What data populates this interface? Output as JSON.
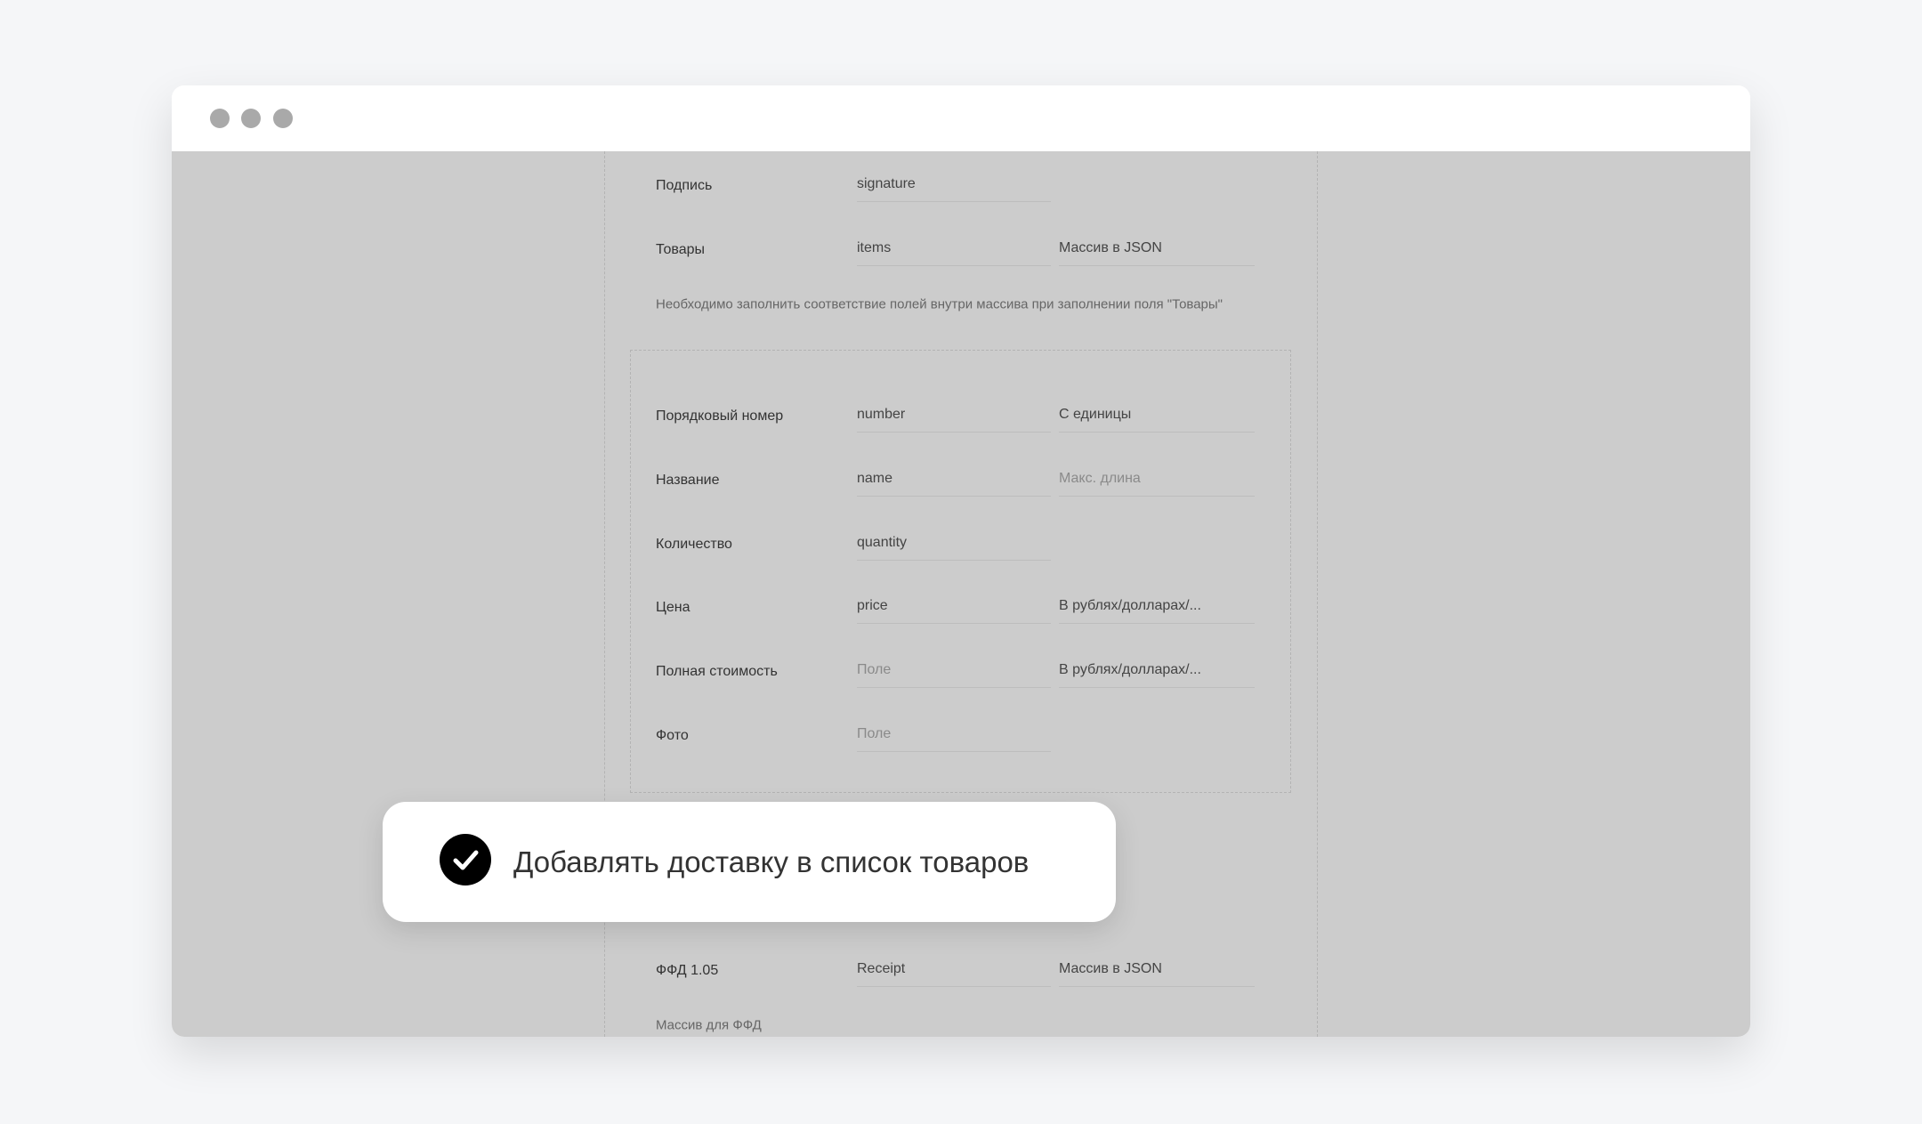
{
  "window": {
    "controls": [
      "close",
      "minimize",
      "maximize"
    ]
  },
  "form": {
    "rows": [
      {
        "label": "Подпись",
        "field": "signature",
        "extra": null
      },
      {
        "label": "Товары",
        "field": "items",
        "extra": "Массив в JSON"
      }
    ],
    "items_note": "Необходимо заполнить соответствие полей внутри массива при заполнении поля \"Товары\"",
    "item_rows": [
      {
        "label": "Порядковый номер",
        "field": "number",
        "extra": "С единицы"
      },
      {
        "label": "Название",
        "field": "name",
        "extra_placeholder": "Макс. длина"
      },
      {
        "label": "Количество",
        "field": "quantity"
      },
      {
        "label": "Цена",
        "field": "price",
        "extra": "В рублях/долларах/..."
      },
      {
        "label": "Полная стоимость",
        "field_placeholder": "Поле",
        "extra": "В рублях/долларах/..."
      },
      {
        "label": "Фото",
        "field_placeholder": "Поле"
      }
    ],
    "ffd": {
      "label": "ФФД 1.05",
      "field": "Receipt",
      "extra": "Массив в JSON",
      "note": "Массив для ФФД"
    }
  },
  "toast": {
    "icon": "check-circle-icon",
    "text": "Добавлять доставку в список товаров",
    "checked": true
  }
}
